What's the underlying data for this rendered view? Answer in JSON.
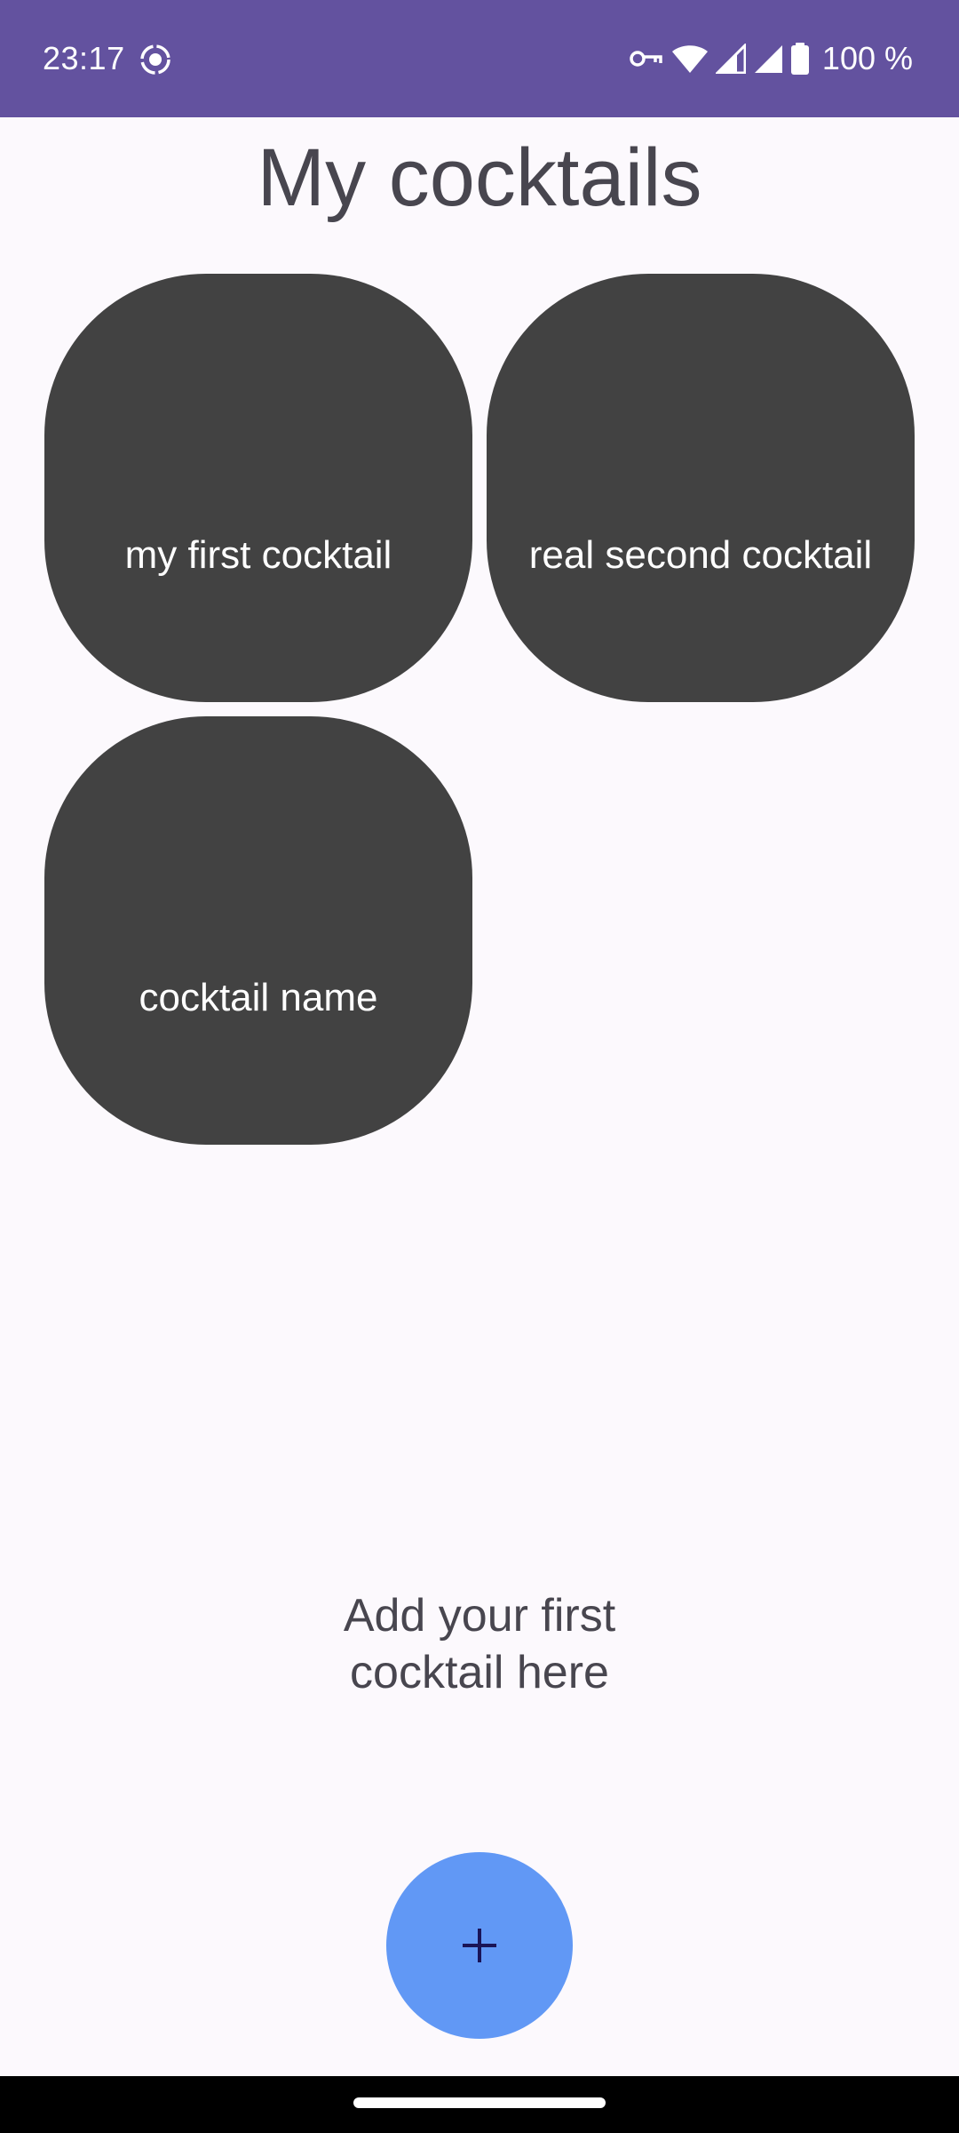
{
  "status_bar": {
    "time": "23:17",
    "battery": "100 %",
    "icons": [
      "screen-record-icon",
      "vpn-key-icon",
      "wifi-icon",
      "signal-icon",
      "signal-icon-2",
      "battery-icon"
    ]
  },
  "page": {
    "title": "My cocktails"
  },
  "cocktails": [
    {
      "name": "my first cocktail"
    },
    {
      "name": "real second cocktail"
    },
    {
      "name": "cocktail name"
    }
  ],
  "empty_hint": {
    "line1": "Add your first",
    "line2": "cocktail here"
  },
  "fab": {
    "icon": "plus-icon"
  },
  "colors": {
    "status_bar": "#63529f",
    "background": "#fcf9fd",
    "card": "#424242",
    "fab": "#6198f5",
    "fab_icon": "#1a1457",
    "title_text": "#48464f"
  }
}
